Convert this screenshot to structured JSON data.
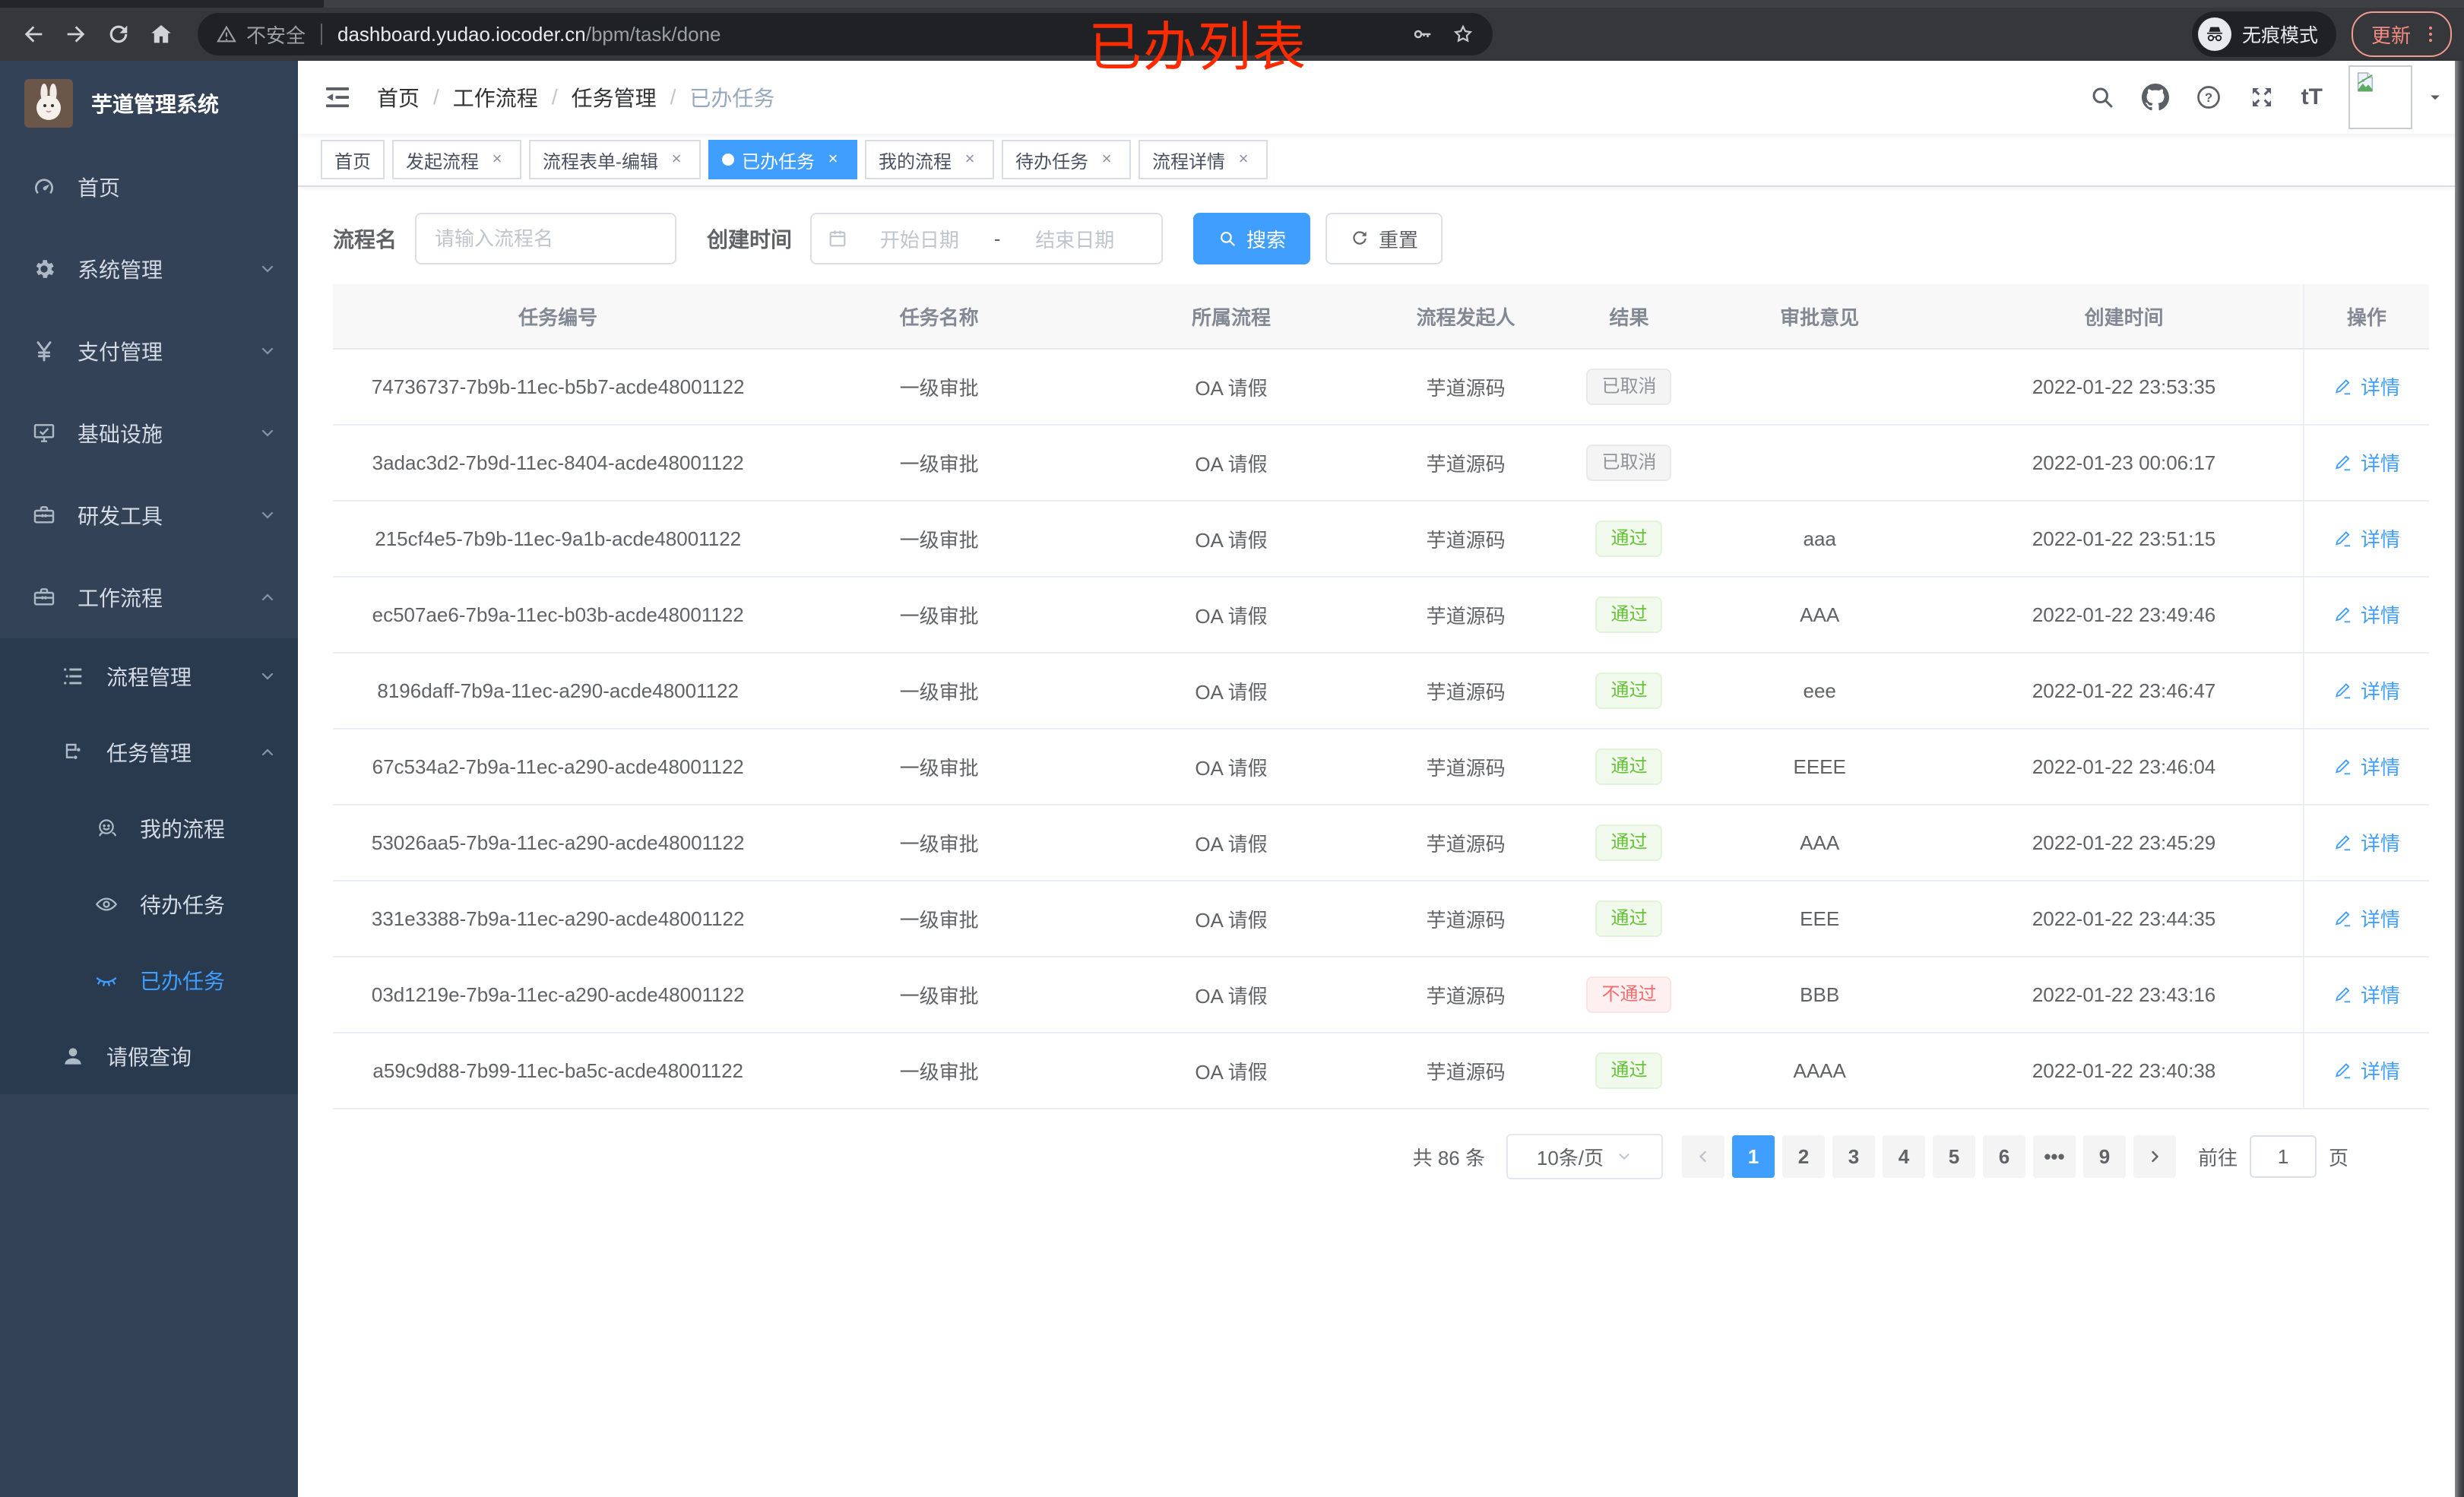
{
  "colors": {
    "accent": "#409eff",
    "success": "#67c23a",
    "danger": "#f56c6c",
    "info": "#909399",
    "overlay_red": "#fe2b00",
    "sidebar_bg": "#344258",
    "submenu_bg": "#293a4f"
  },
  "overlay": {
    "title": "已办列表"
  },
  "browser": {
    "security_label": "不安全",
    "url_host": "dashboard.yudao.iocoder.cn",
    "url_path": "/bpm/task/done",
    "incognito_label": "无痕模式",
    "update_label": "更新"
  },
  "sidebar": {
    "logo_title": "芋道管理系统",
    "menu": [
      {
        "key": "home",
        "label": "首页",
        "icon": "dashboard-icon",
        "level": "root"
      },
      {
        "key": "system",
        "label": "系统管理",
        "icon": "gear-icon",
        "level": "root",
        "chevron": "down"
      },
      {
        "key": "payment",
        "label": "支付管理",
        "icon": "yen-icon",
        "level": "root",
        "chevron": "down"
      },
      {
        "key": "infrastructure",
        "label": "基础设施",
        "icon": "monitor-icon",
        "level": "root",
        "chevron": "down"
      },
      {
        "key": "dev-tools",
        "label": "研发工具",
        "icon": "toolbox-icon",
        "level": "root",
        "chevron": "down"
      },
      {
        "key": "workflow",
        "label": "工作流程",
        "icon": "briefcase-icon",
        "level": "root",
        "chevron": "up"
      },
      {
        "key": "process-mgmt",
        "label": "流程管理",
        "icon": "tree-list-icon",
        "level": "sub",
        "chevron": "down"
      },
      {
        "key": "task-mgmt",
        "label": "任务管理",
        "icon": "share-nodes-icon",
        "level": "sub",
        "chevron": "up"
      },
      {
        "key": "my-process",
        "label": "我的流程",
        "icon": "face-icon",
        "level": "child"
      },
      {
        "key": "todo-tasks",
        "label": "待办任务",
        "icon": "eye-open-icon",
        "level": "child"
      },
      {
        "key": "done-tasks",
        "label": "已办任务",
        "icon": "eye-closed-icon",
        "level": "child",
        "active": true
      },
      {
        "key": "leave-query",
        "label": "请假查询",
        "icon": "user-icon",
        "level": "sub"
      }
    ]
  },
  "navbar": {
    "breadcrumb": [
      "首页",
      "工作流程",
      "任务管理",
      "已办任务"
    ],
    "icons": [
      "search-icon",
      "github-icon",
      "help-icon",
      "fullscreen-icon",
      "font-size-icon"
    ],
    "font_size_glyph": "tT"
  },
  "tagsbar": {
    "tabs": [
      {
        "key": "home",
        "label": "首页",
        "closable": false
      },
      {
        "key": "start-process",
        "label": "发起流程",
        "closable": true
      },
      {
        "key": "form-edit",
        "label": "流程表单-编辑",
        "closable": true
      },
      {
        "key": "done-tasks",
        "label": "已办任务",
        "closable": true,
        "active": true
      },
      {
        "key": "my-process",
        "label": "我的流程",
        "closable": true
      },
      {
        "key": "todo-tasks",
        "label": "待办任务",
        "closable": true
      },
      {
        "key": "process-detail",
        "label": "流程详情",
        "closable": true
      }
    ],
    "close_glyph": "×"
  },
  "filters": {
    "name_label": "流程名",
    "name_placeholder": "请输入流程名",
    "time_label": "创建时间",
    "start_placeholder": "开始日期",
    "range_separator": "-",
    "end_placeholder": "结束日期",
    "search_label": "搜索",
    "reset_label": "重置"
  },
  "table": {
    "columns": [
      "任务编号",
      "任务名称",
      "所属流程",
      "流程发起人",
      "结果",
      "审批意见",
      "创建时间",
      "操作"
    ],
    "column_keys": [
      "task-id",
      "task-name",
      "process",
      "starter",
      "result",
      "opinion",
      "create-time",
      "actions"
    ],
    "column_widths": [
      "21.5%",
      "14.9%",
      "13%",
      "9.4%",
      "6.2%",
      "12%",
      "17.1%",
      "6%"
    ],
    "action_label": "详情",
    "rows": [
      {
        "id": "74736737-7b9b-11ec-b5b7-acde48001122",
        "name": "一级审批",
        "flow": "OA 请假",
        "starter": "芋道源码",
        "result": "已取消",
        "result_type": "info",
        "opinion": "",
        "time": "2022-01-22 23:53:35"
      },
      {
        "id": "3adac3d2-7b9d-11ec-8404-acde48001122",
        "name": "一级审批",
        "flow": "OA 请假",
        "starter": "芋道源码",
        "result": "已取消",
        "result_type": "info",
        "opinion": "",
        "time": "2022-01-23 00:06:17"
      },
      {
        "id": "215cf4e5-7b9b-11ec-9a1b-acde48001122",
        "name": "一级审批",
        "flow": "OA 请假",
        "starter": "芋道源码",
        "result": "通过",
        "result_type": "success",
        "opinion": "aaa",
        "time": "2022-01-22 23:51:15"
      },
      {
        "id": "ec507ae6-7b9a-11ec-b03b-acde48001122",
        "name": "一级审批",
        "flow": "OA 请假",
        "starter": "芋道源码",
        "result": "通过",
        "result_type": "success",
        "opinion": "AAA",
        "time": "2022-01-22 23:49:46"
      },
      {
        "id": "8196daff-7b9a-11ec-a290-acde48001122",
        "name": "一级审批",
        "flow": "OA 请假",
        "starter": "芋道源码",
        "result": "通过",
        "result_type": "success",
        "opinion": "eee",
        "time": "2022-01-22 23:46:47"
      },
      {
        "id": "67c534a2-7b9a-11ec-a290-acde48001122",
        "name": "一级审批",
        "flow": "OA 请假",
        "starter": "芋道源码",
        "result": "通过",
        "result_type": "success",
        "opinion": "EEEE",
        "time": "2022-01-22 23:46:04"
      },
      {
        "id": "53026aa5-7b9a-11ec-a290-acde48001122",
        "name": "一级审批",
        "flow": "OA 请假",
        "starter": "芋道源码",
        "result": "通过",
        "result_type": "success",
        "opinion": "AAA",
        "time": "2022-01-22 23:45:29"
      },
      {
        "id": "331e3388-7b9a-11ec-a290-acde48001122",
        "name": "一级审批",
        "flow": "OA 请假",
        "starter": "芋道源码",
        "result": "通过",
        "result_type": "success",
        "opinion": "EEE",
        "time": "2022-01-22 23:44:35"
      },
      {
        "id": "03d1219e-7b9a-11ec-a290-acde48001122",
        "name": "一级审批",
        "flow": "OA 请假",
        "starter": "芋道源码",
        "result": "不通过",
        "result_type": "danger",
        "opinion": "BBB",
        "time": "2022-01-22 23:43:16"
      },
      {
        "id": "a59c9d88-7b99-11ec-ba5c-acde48001122",
        "name": "一级审批",
        "flow": "OA 请假",
        "starter": "芋道源码",
        "result": "通过",
        "result_type": "success",
        "opinion": "AAAA",
        "time": "2022-01-22 23:40:38"
      }
    ]
  },
  "pagination": {
    "total_label": "共 86 条",
    "page_size": "10条/页",
    "pages": [
      "1",
      "2",
      "3",
      "4",
      "5",
      "6",
      "•••",
      "9"
    ],
    "active_page": "1",
    "goto_label": "前往",
    "goto_value": "1",
    "page_suffix": "页"
  }
}
